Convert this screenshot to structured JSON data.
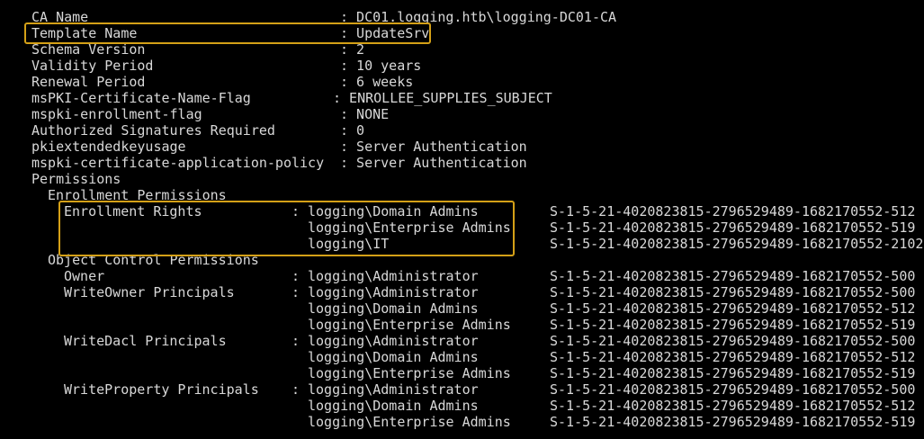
{
  "highlight_color": "#d4a017",
  "text_color": "#d8d8d8",
  "background_color": "#000000",
  "template": {
    "ca_name_label": "CA Name",
    "ca_name_value": ": DC01.logging.htb\\logging-DC01-CA",
    "template_name_label": "Template Name",
    "template_name_value": ": UpdateSrv",
    "schema_version_label": "Schema Version",
    "schema_version_value": ": 2",
    "validity_period_label": "Validity Period",
    "validity_period_value": ": 10 years",
    "renewal_period_label": "Renewal Period",
    "renewal_period_value": ": 6 weeks",
    "name_flag_label": "msPKI-Certificate-Name-Flag",
    "name_flag_value": ": ENROLLEE_SUPPLIES_SUBJECT",
    "enrollment_flag_label": "mspki-enrollment-flag",
    "enrollment_flag_value": ": NONE",
    "auth_signatures_label": "Authorized Signatures Required",
    "auth_signatures_value": ": 0",
    "eku_label": "pkiextendedkeyusage",
    "eku_value": ": Server Authentication",
    "app_policy_label": "mspki-certificate-application-policy",
    "app_policy_value": ": Server Authentication"
  },
  "permissions": {
    "heading": "Permissions",
    "enrollment_heading": "Enrollment Permissions",
    "enrollment_rights_label": "Enrollment Rights",
    "enrollment_rights": [
      {
        "prefix": ": ",
        "principal": "logging\\Domain Admins",
        "sid": "S-1-5-21-4020823815-2796529489-1682170552-512"
      },
      {
        "prefix": "",
        "principal": "logging\\Enterprise Admins",
        "sid": "S-1-5-21-4020823815-2796529489-1682170552-519"
      },
      {
        "prefix": "",
        "principal": "logging\\IT",
        "sid": "S-1-5-21-4020823815-2796529489-1682170552-2102"
      }
    ],
    "object_control_heading": "Object Control Permissions",
    "owner_label": "Owner",
    "owner": {
      "prefix": ": ",
      "principal": "logging\\Administrator",
      "sid": "S-1-5-21-4020823815-2796529489-1682170552-500"
    },
    "writeowner_label": "WriteOwner Principals",
    "writeowner": [
      {
        "prefix": ": ",
        "principal": "logging\\Administrator",
        "sid": "S-1-5-21-4020823815-2796529489-1682170552-500"
      },
      {
        "prefix": "",
        "principal": "logging\\Domain Admins",
        "sid": "S-1-5-21-4020823815-2796529489-1682170552-512"
      },
      {
        "prefix": "",
        "principal": "logging\\Enterprise Admins",
        "sid": "S-1-5-21-4020823815-2796529489-1682170552-519"
      }
    ],
    "writedacl_label": "WriteDacl Principals",
    "writedacl": [
      {
        "prefix": ": ",
        "principal": "logging\\Administrator",
        "sid": "S-1-5-21-4020823815-2796529489-1682170552-500"
      },
      {
        "prefix": "",
        "principal": "logging\\Domain Admins",
        "sid": "S-1-5-21-4020823815-2796529489-1682170552-512"
      },
      {
        "prefix": "",
        "principal": "logging\\Enterprise Admins",
        "sid": "S-1-5-21-4020823815-2796529489-1682170552-519"
      }
    ],
    "writeproperty_label": "WriteProperty Principals",
    "writeproperty": [
      {
        "prefix": ": ",
        "principal": "logging\\Administrator",
        "sid": "S-1-5-21-4020823815-2796529489-1682170552-500"
      },
      {
        "prefix": "",
        "principal": "logging\\Domain Admins",
        "sid": "S-1-5-21-4020823815-2796529489-1682170552-512"
      },
      {
        "prefix": "",
        "principal": "logging\\Enterprise Admins",
        "sid": "S-1-5-21-4020823815-2796529489-1682170552-519"
      }
    ]
  }
}
